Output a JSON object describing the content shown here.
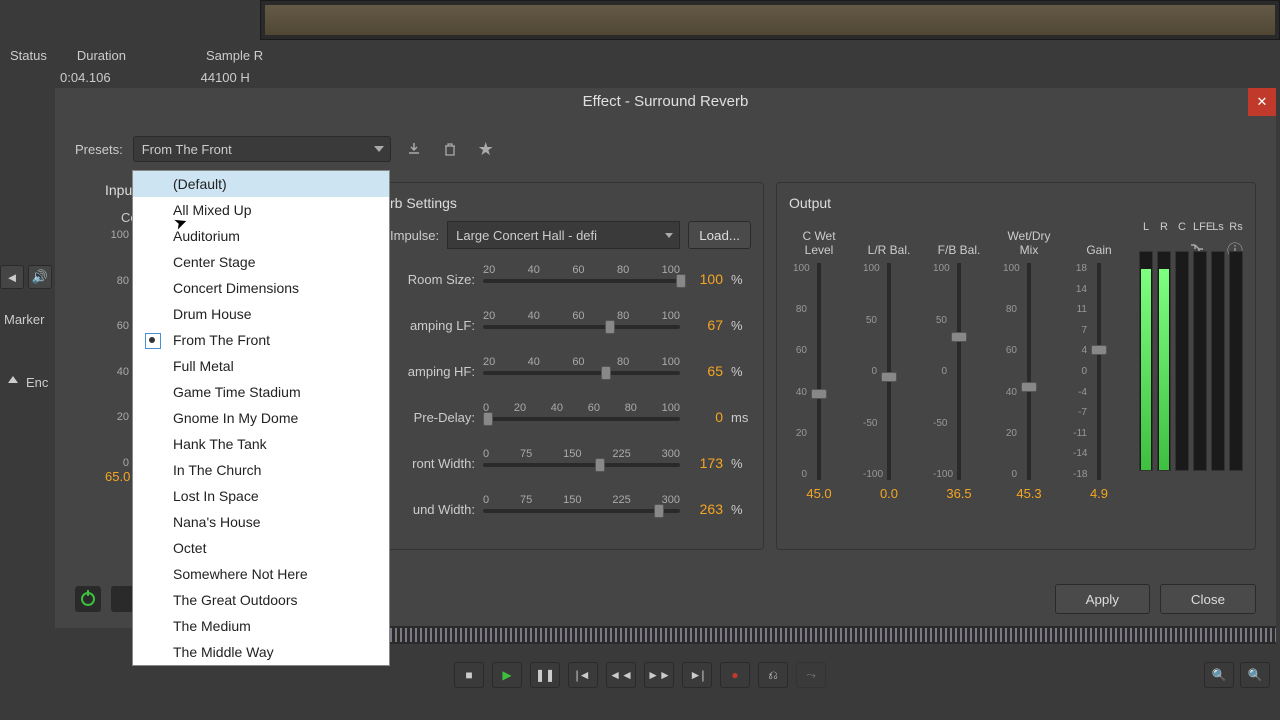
{
  "top": {
    "status": "Status",
    "duration": "Duration",
    "sample": "Sample R",
    "duration_val": "0:04.106",
    "sample_val": "44100 H"
  },
  "left": {
    "marker": "Marker",
    "enc": "Enc"
  },
  "dialog": {
    "title": "Effect - Surround Reverb",
    "presets_label": "Presets:",
    "preset_selected": "From The Front",
    "input_label": "Input",
    "ce_label": "Ce",
    "reverb": {
      "title": "rb Settings",
      "impulse_label": "Impulse:",
      "impulse_value": "Large Concert Hall - defi",
      "load": "Load...",
      "rows": [
        {
          "label": "Room Size:",
          "ticks": [
            "20",
            "40",
            "60",
            "80",
            "100"
          ],
          "value": "100",
          "unit": "%",
          "pos": 98
        },
        {
          "label": "amping LF:",
          "ticks": [
            "20",
            "40",
            "60",
            "80",
            "100"
          ],
          "value": "67",
          "unit": "%",
          "pos": 62
        },
        {
          "label": "amping HF:",
          "ticks": [
            "20",
            "40",
            "60",
            "80",
            "100"
          ],
          "value": "65",
          "unit": "%",
          "pos": 60
        },
        {
          "label": "Pre-Delay:",
          "ticks": [
            "0",
            "20",
            "40",
            "60",
            "80",
            "100"
          ],
          "value": "0",
          "unit": "ms",
          "pos": 0
        },
        {
          "label": "ront Width:",
          "ticks": [
            "0",
            "75",
            "150",
            "225",
            "300"
          ],
          "value": "173",
          "unit": "%",
          "pos": 57
        },
        {
          "label": "und Width:",
          "ticks": [
            "0",
            "75",
            "150",
            "225",
            "300"
          ],
          "value": "263",
          "unit": "%",
          "pos": 87
        }
      ]
    },
    "output": {
      "title": "Output",
      "cols": [
        {
          "h1": "C Wet",
          "h2": "Level",
          "ticks": [
            "100",
            "80",
            "60",
            "40",
            "20",
            "0"
          ],
          "val": "45.0",
          "pos": 58
        },
        {
          "h1": "",
          "h2": "L/R Bal.",
          "ticks": [
            "100",
            "50",
            "0",
            "-50",
            "-100"
          ],
          "val": "0.0",
          "pos": 50
        },
        {
          "h1": "",
          "h2": "F/B Bal.",
          "ticks": [
            "100",
            "50",
            "0",
            "-50",
            "-100"
          ],
          "val": "36.5",
          "pos": 32
        },
        {
          "h1": "Wet/Dry",
          "h2": "Mix",
          "ticks": [
            "100",
            "80",
            "60",
            "40",
            "20",
            "0"
          ],
          "val": "45.3",
          "pos": 55
        },
        {
          "h1": "",
          "h2": "Gain",
          "ticks": [
            "18",
            "14",
            "11",
            "7",
            "4",
            "0",
            "-4",
            "-7",
            "-11",
            "-14",
            "-18"
          ],
          "val": "4.9",
          "pos": 38
        }
      ],
      "meters": [
        "L",
        "R",
        "C",
        "LFE",
        "Ls",
        "Rs"
      ],
      "meter_fills": [
        92,
        92,
        0,
        0,
        0,
        0
      ]
    },
    "apply": "Apply",
    "close_btn": "Close",
    "left_value": "65.0"
  },
  "dropdown": {
    "items": [
      {
        "label": "(Default)",
        "hl": true
      },
      {
        "label": "All Mixed Up"
      },
      {
        "label": "Auditorium"
      },
      {
        "label": "Center Stage"
      },
      {
        "label": "Concert Dimensions"
      },
      {
        "label": "Drum House"
      },
      {
        "label": "From The Front",
        "sel": true
      },
      {
        "label": "Full Metal"
      },
      {
        "label": "Game Time Stadium"
      },
      {
        "label": "Gnome In My Dome"
      },
      {
        "label": "Hank The Tank"
      },
      {
        "label": "In The Church"
      },
      {
        "label": "Lost In Space"
      },
      {
        "label": "Nana's House"
      },
      {
        "label": "Octet"
      },
      {
        "label": "Somewhere Not Here"
      },
      {
        "label": "The Great Outdoors"
      },
      {
        "label": "The Medium"
      },
      {
        "label": "The Middle Way"
      }
    ]
  },
  "input_ticks": [
    "100",
    "80",
    "60",
    "40",
    "20",
    "0"
  ]
}
